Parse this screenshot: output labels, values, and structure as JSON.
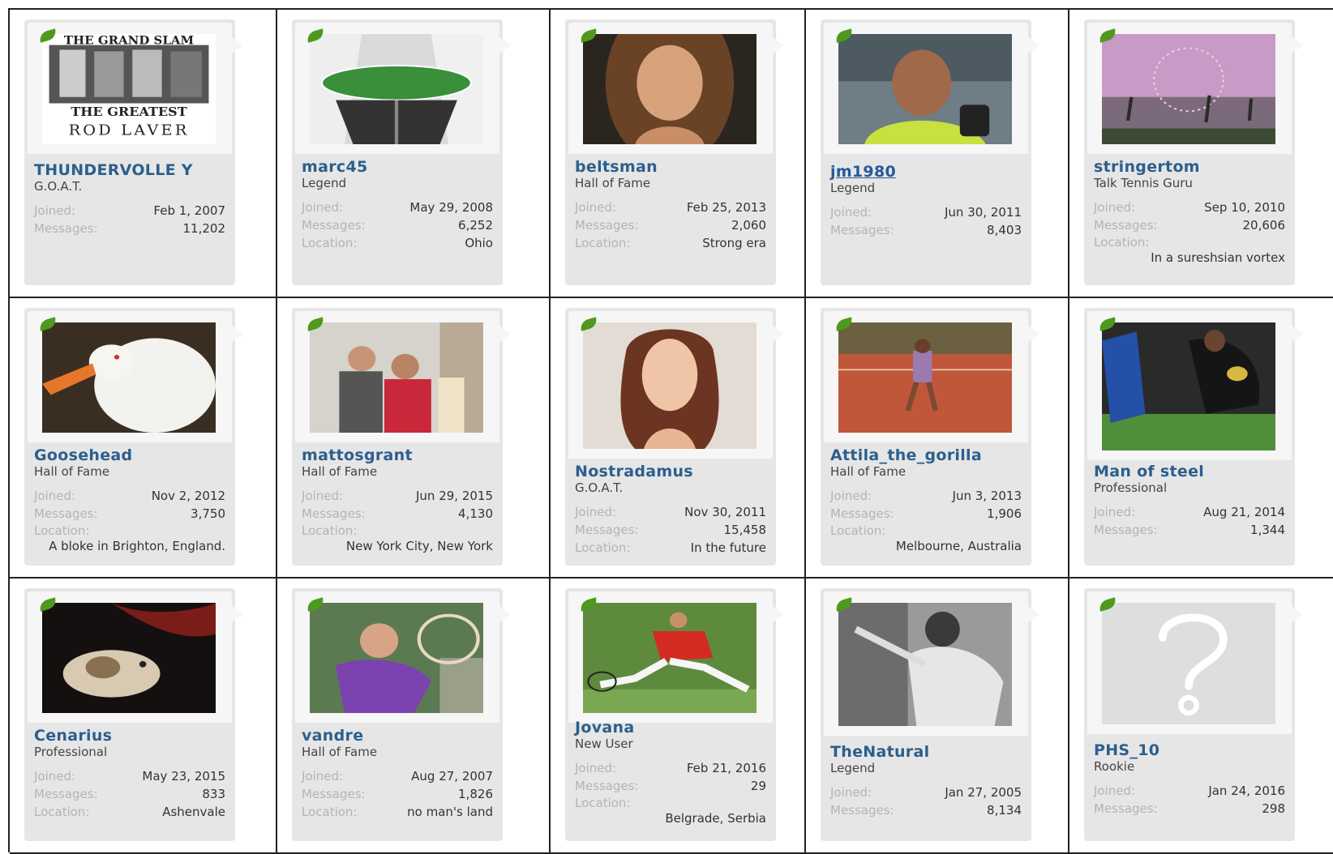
{
  "labels": {
    "joined": "Joined:",
    "messages": "Messages:",
    "location": "Location:"
  },
  "members": [
    {
      "name": "THUNDERVOLLE Y",
      "title": "G.O.A.T.",
      "joined": "Feb 1, 2007",
      "messages": "11,202",
      "location": "",
      "avatar_text": [
        "THE GRAND SLAM",
        "THE GREATEST",
        "ROD LAVER"
      ],
      "avatar": "rod-laver-avatar"
    },
    {
      "name": "marc45",
      "title": "Legend",
      "joined": "May 29, 2008",
      "messages": "6,252",
      "location": "Ohio",
      "avatar": "tennis-court-avatar"
    },
    {
      "name": "beltsman",
      "title": "Hall of Fame",
      "joined": "Feb 25, 2013",
      "messages": "2,060",
      "location": "Strong era",
      "avatar": "long-hair-man-avatar"
    },
    {
      "name": "jm1980",
      "title": "Legend",
      "joined": "Jun 30, 2011",
      "messages": "8,403",
      "location": "",
      "avatar": "player-interview-avatar"
    },
    {
      "name": "stringertom",
      "title": "Talk Tennis Guru",
      "joined": "Sep 10, 2010",
      "messages": "20,606",
      "location": "In a sureshsian vortex",
      "avatar": "ferris-wheel-avatar"
    },
    {
      "name": "Goosehead",
      "title": "Hall of Fame",
      "joined": "Nov 2, 2012",
      "messages": "3,750",
      "location": "A bloke in Brighton, England.",
      "avatar": "goose-avatar"
    },
    {
      "name": "mattosgrant",
      "title": "Hall of Fame",
      "joined": "Jun 29, 2015",
      "messages": "4,130",
      "location": "New York City, New York",
      "avatar": "group-photo-avatar"
    },
    {
      "name": "Nostradamus",
      "title": "G.O.A.T.",
      "joined": "Nov 30, 2011",
      "messages": "15,458",
      "location": "In the future",
      "avatar": "woman-portrait-avatar"
    },
    {
      "name": "Attila_the_gorilla",
      "title": "Hall of Fame",
      "joined": "Jun 3, 2013",
      "messages": "1,906",
      "location": "Melbourne, Australia",
      "avatar": "clay-court-avatar"
    },
    {
      "name": "Man of steel",
      "title": "Professional",
      "joined": "Aug 21, 2014",
      "messages": "1,344",
      "location": "",
      "avatar": "rugby-avatar"
    },
    {
      "name": "Cenarius",
      "title": "Professional",
      "joined": "May 23, 2015",
      "messages": "833",
      "location": "Ashenvale",
      "avatar": "cat-avatar"
    },
    {
      "name": "vandre",
      "title": "Hall of Fame",
      "joined": "Aug 27, 2007",
      "messages": "1,826",
      "location": "no man's land",
      "avatar": "tennis-swing-avatar"
    },
    {
      "name": "Jovana",
      "title": "New User",
      "joined": "Feb 21, 2016",
      "messages": "29",
      "location": "Belgrade, Serbia",
      "avatar": "tennis-slide-avatar"
    },
    {
      "name": "TheNatural",
      "title": "Legend",
      "joined": "Jan 27, 2005",
      "messages": "8,134",
      "location": "",
      "avatar": "bw-tennis-avatar"
    },
    {
      "name": "PHS_10",
      "title": "Rookie",
      "joined": "Jan 24, 2016",
      "messages": "298",
      "location": "",
      "avatar": "default-question-avatar"
    }
  ]
}
